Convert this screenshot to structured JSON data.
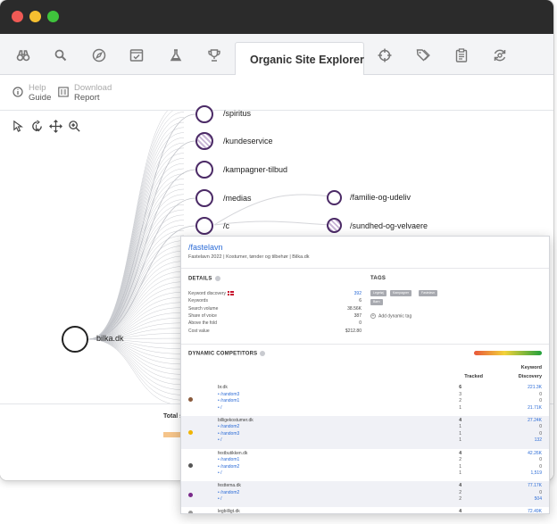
{
  "tabs": {
    "active_label": "Organic Site Explorer",
    "icons": [
      "binoculars-icon",
      "search-icon",
      "compass-icon",
      "browser-check-icon",
      "flask-icon",
      "trophy-icon",
      "sitemap-icon",
      "crosshair-icon",
      "tags-icon",
      "clipboard-icon",
      "settings-sync-icon"
    ]
  },
  "toolbar": {
    "help_top": "Help",
    "help_bottom": "Guide",
    "download_top": "Download",
    "download_bottom": "Report"
  },
  "tree": {
    "root": "bilka.dk",
    "nodes": [
      "/spiritus",
      "/kundeservice",
      "/kampagner-tilbud",
      "/medias",
      "/c"
    ],
    "child_nodes": [
      "/familie-og-udeliv",
      "/sundhed-og-velvaere"
    ]
  },
  "bottom": {
    "total_label": "Total s"
  },
  "panel": {
    "title": "/fastelavn",
    "subtitle": "Fastelavn 2022 | Kostumer, tønder og tilbehør | Bilka.dk",
    "details_heading": "DETAILS",
    "details": [
      {
        "label": "Keyword discovery",
        "value": "392",
        "flag": true,
        "blue": true
      },
      {
        "label": "Keywords",
        "value": "6"
      },
      {
        "label": "Search volume",
        "value": "38.56K"
      },
      {
        "label": "Share of voice",
        "value": "387"
      },
      {
        "label": "Above the fold",
        "value": "0"
      },
      {
        "label": "Cost value",
        "value": "$212.80"
      }
    ],
    "tags_heading": "TAGS",
    "tags": [
      "Legetøj",
      "Kampagner",
      "Fastelavn",
      "Børn"
    ],
    "add_tag": "Add dynamic tag",
    "competitors_heading": "DYNAMIC COMPETITORS",
    "col_tracked": "Tracked",
    "col_kd_1": "Keyword",
    "col_kd_2": "Discovery",
    "competitors": [
      {
        "name": "br.dk",
        "tracked": "6",
        "kd": "221.3K",
        "color": "#8a5a3c",
        "rows": [
          {
            "path": "• /random3",
            "tracked": "3",
            "kd": "0"
          },
          {
            "path": "• /random1",
            "tracked": "2",
            "kd": "0"
          },
          {
            "path": "• /",
            "tracked": "1",
            "kd": "21.71K"
          }
        ]
      },
      {
        "name": "billigekostumer.dk",
        "tracked": "4",
        "kd": "27.24K",
        "color": "#f0b400",
        "rows": [
          {
            "path": "• /random2",
            "tracked": "1",
            "kd": "0"
          },
          {
            "path": "• /random3",
            "tracked": "1",
            "kd": "0"
          },
          {
            "path": "• /",
            "tracked": "1",
            "kd": "132"
          }
        ]
      },
      {
        "name": "festbutikken.dk",
        "tracked": "4",
        "kd": "42.26K",
        "color": "#555555",
        "rows": [
          {
            "path": "• /random1",
            "tracked": "2",
            "kd": "0"
          },
          {
            "path": "• /random2",
            "tracked": "1",
            "kd": "0"
          },
          {
            "path": "• /",
            "tracked": "1",
            "kd": "1,519"
          }
        ]
      },
      {
        "name": "festtema.dk",
        "tracked": "4",
        "kd": "77.17K",
        "color": "#7a2a8a",
        "rows": [
          {
            "path": "• /random2",
            "tracked": "2",
            "kd": "0"
          },
          {
            "path": "• /",
            "tracked": "2",
            "kd": "504"
          }
        ]
      },
      {
        "name": "legbilligt.dk",
        "tracked": "4",
        "kd": "72.49K",
        "color": "#999999",
        "rows": []
      }
    ]
  }
}
